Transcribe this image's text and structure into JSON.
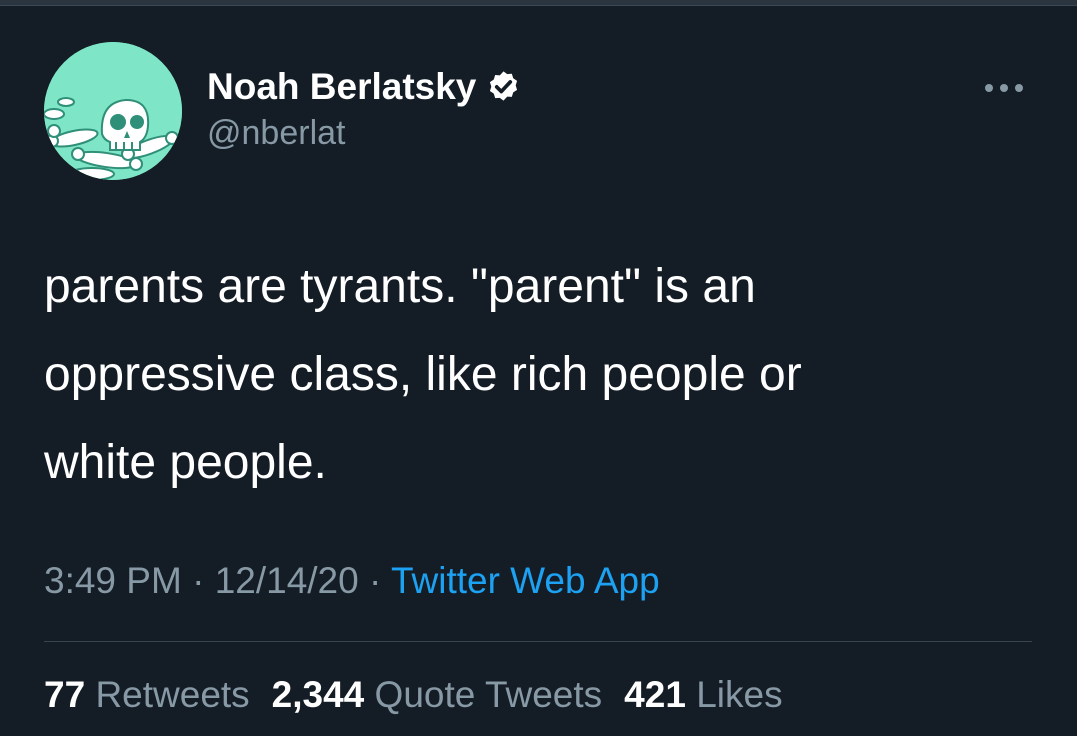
{
  "author": {
    "display_name": "Noah Berlatsky",
    "handle": "@nberlat",
    "avatar_icon": "skull-and-bones-avatar",
    "verified_icon": "verified-badge-icon"
  },
  "more_icon": "more-options-icon",
  "tweet": {
    "text": "parents are tyrants. \"parent\" is an\noppressive class, like rich people or\nwhite people."
  },
  "meta": {
    "time": "3:49 PM",
    "sep1": " · ",
    "date": "12/14/20",
    "sep2": " · ",
    "source": "Twitter Web App"
  },
  "stats": {
    "retweets_count": "77",
    "retweets_label": "Retweets",
    "quotes_count": "2,344",
    "quotes_label": "Quote Tweets",
    "likes_count": "421",
    "likes_label": "Likes"
  },
  "colors": {
    "background": "#141d26",
    "text_primary": "#ffffff",
    "text_secondary": "#8899a6",
    "link": "#1da1f2",
    "avatar_bg": "#7ee6c6"
  }
}
